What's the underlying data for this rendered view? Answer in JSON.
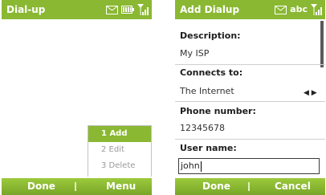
{
  "left_screen": {
    "title": "Dial-up",
    "menu": {
      "items": [
        "1 Add",
        "2 Edit",
        "3 Delete"
      ],
      "selected_index": 0
    },
    "softkeys": {
      "left": "Done",
      "right": "Menu"
    }
  },
  "right_screen": {
    "title": "Add Dialup",
    "status_text": "abc",
    "fields": {
      "description_label": "Description:",
      "description_value": "My ISP",
      "connects_to_label": "Connects to:",
      "connects_to_value": "The Internet",
      "phone_label": "Phone number:",
      "phone_value": "12345678",
      "username_label": "User name:",
      "username_value": "john"
    },
    "softkeys": {
      "left": "Done",
      "right": "Cancel"
    }
  },
  "colors": {
    "accent_green": "#8ab832",
    "menu_disabled": "#9a9a9a"
  },
  "icons": [
    "envelope-icon",
    "battery-icon",
    "signal-icon",
    "left-arrow-icon",
    "right-arrow-icon"
  ]
}
